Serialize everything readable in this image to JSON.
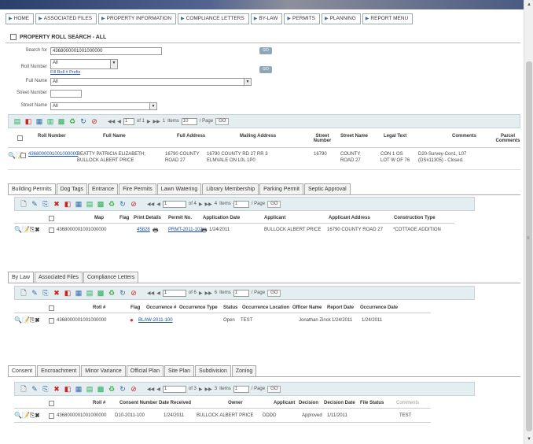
{
  "nav": [
    "HOME",
    "ASSOCIATED FILES",
    "PROPERTY INFORMATION",
    "COMPLIANCE LETTERS",
    "BY-LAW",
    "PERMITS",
    "PLANNING",
    "REPORT MENU"
  ],
  "title": "PROPERTY ROLL SEARCH - ALL",
  "search": {
    "search_for_label": "Search for",
    "search_for_value": "4368000001001000000",
    "go": "GO",
    "roll_number_label": "Roll Number",
    "roll_number_value": "All",
    "fill_roll_link": "Fill Roll # Prefix",
    "full_name_label": "Full Name",
    "full_name_value": "All",
    "street_number_label": "Street Number",
    "street_number_value": "",
    "street_name_label": "Street Name",
    "street_name_value": "All"
  },
  "main_pager": {
    "page": "1",
    "of": "of 1",
    "items": "1",
    "items_label": "Items",
    "per_page": "10",
    "per_page_label": "/ Page",
    "go": "GO"
  },
  "main_grid": {
    "headers": [
      "Roll Number",
      "Full Name",
      "Full Address",
      "Mailing Address",
      "Street Number",
      "Street Name",
      "Legal Text",
      "Comments",
      "Parcel Comments"
    ],
    "row": {
      "roll": "4368000001001000000",
      "name1": "BEATTY PATRICIA ELIZABETH;",
      "name2": "BULLOCK ALBERT PRICE",
      "addr1": "16790 COUNTY",
      "addr2": "ROAD 27",
      "mail1": "16790 COUNTY RD 27 RR 3",
      "mail2": "ELMVALE ON L0L 1P0",
      "street_no": "16790",
      "street1": "COUNTY",
      "street2": "ROAD 27",
      "legal1": "CON 1 OS",
      "legal2": "LOT W OF 76",
      "comments1": "D20-Survey-Con1, L07",
      "comments2": "(DS#11305) - Closed."
    }
  },
  "section1": {
    "tabs": [
      "Building Permits",
      "Dog Tags",
      "Entrance",
      "Fire Permits",
      "Lawn Watering",
      "Library Membership",
      "Parking Permit",
      "Septic Approval"
    ],
    "pager": {
      "page": "1",
      "of": "of 4",
      "items": "4",
      "items_label": "Items",
      "per_page": "1",
      "per_page_label": "/ Page",
      "go": "GO"
    },
    "headers": [
      "Map",
      "Flag",
      "Print Details",
      "Permit No.",
      "Application Date",
      "Applicant",
      "Applicant Address",
      "Construction Type"
    ],
    "row": {
      "roll": "4368000001001000000",
      "print": "45828",
      "permit": "PRMT-2011-102",
      "date": "1/24/2011",
      "applicant": "BULLOCK ALBERT PRICE",
      "address": "16790 COUNTY ROAD 27",
      "type": "*COTTAGE ADDITION"
    }
  },
  "section2": {
    "tabs": [
      "By Law",
      "Associated Files",
      "Compliance Letters"
    ],
    "pager": {
      "page": "1",
      "of": "of 6",
      "items": "6",
      "items_label": "Items",
      "per_page": "1",
      "per_page_label": "/ Page",
      "go": "GO"
    },
    "headers": [
      "Roll #",
      "Flag",
      "Occurrence #",
      "Occurrence Type",
      "Status",
      "Occurrence Location",
      "Officer Name",
      "Report Date",
      "Occurrence Date"
    ],
    "row": {
      "roll": "4368000001001000000",
      "occ": "BLAW-2011-100",
      "status": "Open",
      "location": "TEST",
      "officer": "Jonathan Zinck",
      "report": "1/24/2011",
      "occdate": "1/24/2011"
    }
  },
  "section3": {
    "tabs": [
      "Consent",
      "Encroachment",
      "Minor Variance",
      "Official Plan",
      "Site Plan",
      "Subdivision",
      "Zoning"
    ],
    "pager": {
      "page": "1",
      "of": "of 3",
      "items": "3",
      "items_label": "Items",
      "per_page": "1",
      "per_page_label": "/ Page",
      "go": "GO"
    },
    "headers": [
      "Roll #",
      "Consent Number",
      "Date Received",
      "Owner",
      "Applicant",
      "Decision",
      "Decision Date",
      "File Status",
      "Comments"
    ],
    "row": {
      "roll": "4368000001001000000",
      "consent": "D10-2011-100",
      "received": "1/24/2011",
      "owner": "BULLOCK ALBERT PRICE",
      "applicant": "DDDD",
      "decision": "Approved",
      "decdate": "1/11/2011",
      "status": "TEST"
    }
  }
}
